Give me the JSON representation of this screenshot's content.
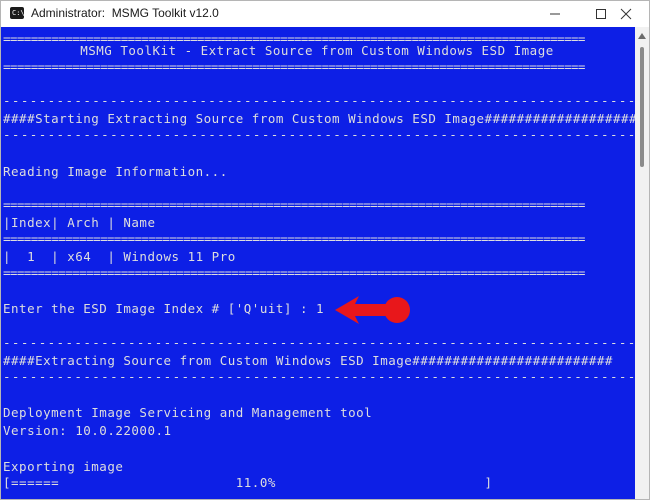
{
  "window": {
    "title": "Administrator:  MSMG Toolkit v12.0",
    "icon_text": "C:\\"
  },
  "colors": {
    "console_bg": "#0d1fe6",
    "console_text": "#dedede",
    "annotation_arrow": "#e8171b"
  },
  "console": {
    "sep_eq": "====================================================================================",
    "sep_dash": "----------------------------------------------------------------------------------------------",
    "header": "MSMG ToolKit - Extract Source from Custom Windows ESD Image",
    "starting": "####Starting Extracting Source from Custom Windows ESD Image####################",
    "reading": "Reading Image Information...",
    "table_header": "|Index| Arch | Name",
    "table_row": "|  1  | x64  | Windows 11 Pro",
    "prompt": "Enter the ESD Image Index # ['Q'uit] : 1",
    "extracting": "####Extracting Source from Custom Windows ESD Image#########################",
    "dism_title": "Deployment Image Servicing and Management tool",
    "version": "Version: 10.0.22000.1",
    "exporting": "Exporting image",
    "progress_line": "[======                      11.0%                          ]"
  },
  "progress": {
    "percent": 11.0
  }
}
